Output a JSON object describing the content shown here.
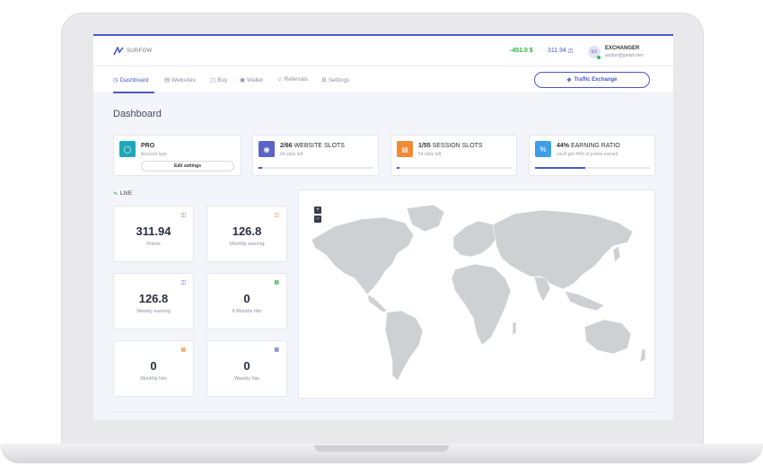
{
  "brand": {
    "name": "SURFOW"
  },
  "header": {
    "balance_green": "-451.0 $",
    "balance_blue": "311.94",
    "avatar_initials": "EX",
    "user_name": "EXCHANGER",
    "user_email": "azzfun@gmail.com"
  },
  "nav": {
    "items": [
      {
        "label": "Dashboard",
        "icon": "dashboard-icon"
      },
      {
        "label": "Websites",
        "icon": "websites-icon"
      },
      {
        "label": "Buy",
        "icon": "buy-icon"
      },
      {
        "label": "Wallet",
        "icon": "wallet-icon"
      },
      {
        "label": "Referrals",
        "icon": "referrals-icon"
      },
      {
        "label": "Settings",
        "icon": "settings-icon"
      }
    ],
    "traffic_button": "Traffic Exchange"
  },
  "page": {
    "title": "Dashboard",
    "live_label": "LIVE"
  },
  "stat_cards": [
    {
      "bold": "PRO",
      "title": "",
      "sub": "Account type",
      "button": "Edit settings",
      "color": "#1ea7b8"
    },
    {
      "bold": "2/66",
      "title": " WEBSITE SLOTS",
      "sub": "64 slots left",
      "color": "#5b63c9",
      "progress": 0.03
    },
    {
      "bold": "1/55",
      "title": " SESSION SLOTS",
      "sub": "54 slots left",
      "color": "#f18a33",
      "progress": 0.02
    },
    {
      "bold": "44%",
      "title": " EARNING RATIO",
      "sub": "you'll get 44% of points earned",
      "color": "#3d9de8",
      "progress": 0.44
    }
  ],
  "metrics": [
    {
      "value": "311.94",
      "label": "Points",
      "icon": "coins-icon",
      "icon_color": "#29b13a"
    },
    {
      "value": "126.8",
      "label": "Monthly earning",
      "icon": "coins-icon",
      "icon_color": "#f18a33"
    },
    {
      "value": "126.8",
      "label": "Weekly earning",
      "icon": "coins-icon",
      "icon_color": "#5b63c9"
    },
    {
      "value": "0",
      "label": "6 Months hits",
      "icon": "bar-chart-icon",
      "icon_color": "#29b13a"
    },
    {
      "value": "0",
      "label": "Monthly hits",
      "icon": "bar-chart-icon",
      "icon_color": "#f18a33"
    },
    {
      "value": "0",
      "label": "Weekly hits",
      "icon": "bar-chart-icon",
      "icon_color": "#5b63c9"
    }
  ],
  "map": {
    "zoom_in": "+",
    "zoom_out": "−"
  }
}
